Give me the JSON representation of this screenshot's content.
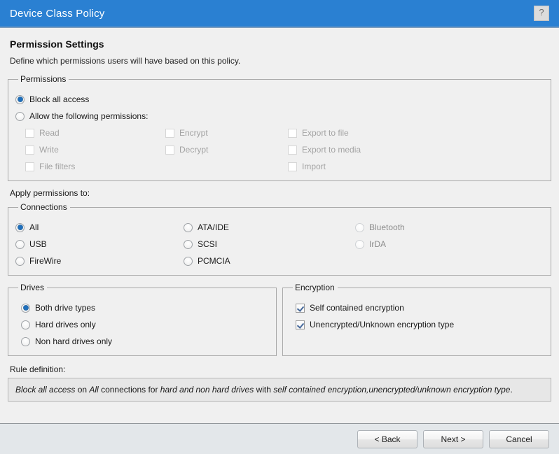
{
  "window": {
    "title": "Device Class Policy",
    "help_icon": "question-mark-icon",
    "help_label": "?",
    "accent_color": "#2a80d2"
  },
  "page": {
    "title": "Permission Settings",
    "subtitle": "Define which permissions users will have based on this policy."
  },
  "permissions": {
    "legend": "Permissions",
    "mode_options": [
      {
        "label": "Block all access",
        "selected": true
      },
      {
        "label": "Allow the following permissions:",
        "selected": false
      }
    ],
    "columns": [
      [
        {
          "label": "Read",
          "checked": false,
          "disabled": true
        },
        {
          "label": "Write",
          "checked": false,
          "disabled": true
        },
        {
          "label": "File filters",
          "checked": false,
          "disabled": true
        }
      ],
      [
        {
          "label": "Encrypt",
          "checked": false,
          "disabled": true
        },
        {
          "label": "Decrypt",
          "checked": false,
          "disabled": true
        }
      ],
      [
        {
          "label": "Export to file",
          "checked": false,
          "disabled": true
        },
        {
          "label": "Export to media",
          "checked": false,
          "disabled": true
        },
        {
          "label": "Import",
          "checked": false,
          "disabled": true
        }
      ]
    ]
  },
  "apply_label": "Apply permissions to:",
  "connections": {
    "legend": "Connections",
    "columns": [
      [
        {
          "label": "All",
          "selected": true,
          "disabled": false
        },
        {
          "label": "USB",
          "selected": false,
          "disabled": false
        },
        {
          "label": "FireWire",
          "selected": false,
          "disabled": false
        }
      ],
      [
        {
          "label": "ATA/IDE",
          "selected": false,
          "disabled": false
        },
        {
          "label": "SCSI",
          "selected": false,
          "disabled": false
        },
        {
          "label": "PCMCIA",
          "selected": false,
          "disabled": false
        }
      ],
      [
        {
          "label": "Bluetooth",
          "selected": false,
          "disabled": true
        },
        {
          "label": "IrDA",
          "selected": false,
          "disabled": true
        }
      ]
    ]
  },
  "drives": {
    "legend": "Drives",
    "options": [
      {
        "label": "Both drive types",
        "selected": true
      },
      {
        "label": "Hard drives only",
        "selected": false
      },
      {
        "label": "Non hard drives only",
        "selected": false
      }
    ]
  },
  "encryption": {
    "legend": "Encryption",
    "options": [
      {
        "label": "Self contained encryption",
        "checked": true
      },
      {
        "label": "Unencrypted/Unknown encryption type",
        "checked": true
      }
    ]
  },
  "rule": {
    "title": "Rule definition:",
    "parts": [
      {
        "text": "Block all access",
        "italic": true
      },
      {
        "text": " on ",
        "italic": false
      },
      {
        "text": "All",
        "italic": true
      },
      {
        "text": " connections for ",
        "italic": false
      },
      {
        "text": "hard and non hard drives",
        "italic": true
      },
      {
        "text": " with ",
        "italic": false
      },
      {
        "text": "self contained encryption,unencrypted/unknown encryption type",
        "italic": true
      },
      {
        "text": ".",
        "italic": false
      }
    ]
  },
  "footer": {
    "back_label": "< Back",
    "next_label": "Next >",
    "cancel_label": "Cancel"
  }
}
